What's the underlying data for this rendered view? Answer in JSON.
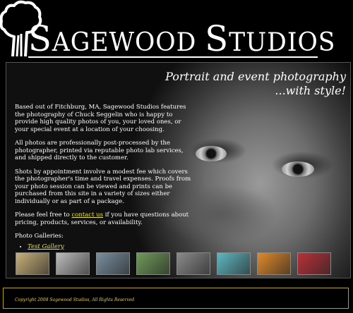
{
  "header": {
    "title_first_initial": "S",
    "title_first_rest": "AGEWOOD ",
    "title_second_initial": "S",
    "title_second_rest": "TUDIOS"
  },
  "tagline": {
    "line1": "Portrait and event photography",
    "line2": "...with style!"
  },
  "content": {
    "p1": "Based out of Fitchburg, MA, Sagewood Studios features the photography of Chuck Seggelin who is happy to provide high quality photos of you, your loved ones, or your special event at a location of your choosing.",
    "p2": "All photos are professionally post-processed by the photographer, printed via reputable photo lab services, and shipped directly to the customer.",
    "p3": "Shots by appointment involve a modest fee which covers the photographer's time and travel expenses. Proofs from your photo session can be viewed and prints can be purchased from this site in a variety of sizes either individually or as part of a package.",
    "p4_before": "Please feel free to ",
    "p4_link": "contact us",
    "p4_after": " if you have questions about pricing, products, services, or availability.",
    "galleries_heading": "Photo Galleries:",
    "gallery_link": "Test Gallery"
  },
  "thumbnails": [
    {
      "alt": "girl in straw hat",
      "color": "#c9b07a"
    },
    {
      "alt": "black and white portrait",
      "color": "#bdbdbd"
    },
    {
      "alt": "kayakers on water",
      "color": "#7a8fa0"
    },
    {
      "alt": "girl on grass",
      "color": "#6f9a58"
    },
    {
      "alt": "close-up portrait",
      "color": "#8a8a8a"
    },
    {
      "alt": "dancer by fountain",
      "color": "#5fb7c2"
    },
    {
      "alt": "sunset",
      "color": "#e08a2a"
    },
    {
      "alt": "girl with flowers",
      "color": "#b8323a"
    }
  ],
  "footer": {
    "copyright": "Copyright 2008 Sagewood Studios, All Rights Reserved"
  }
}
